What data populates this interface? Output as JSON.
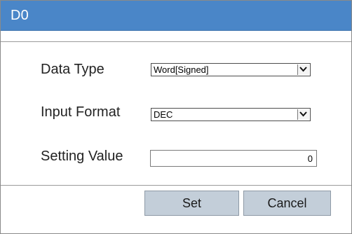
{
  "dialog": {
    "title": "D0"
  },
  "form": {
    "data_type": {
      "label": "Data Type",
      "value": "Word[Signed]",
      "icon": "chevron-down-icon"
    },
    "input_format": {
      "label": "Input Format",
      "value": "DEC",
      "icon": "chevron-down-icon"
    },
    "setting_value": {
      "label": "Setting Value",
      "value": "0"
    }
  },
  "buttons": {
    "set_label": "Set",
    "cancel_label": "Cancel"
  },
  "colors": {
    "titlebar": "#4a86c8",
    "button": "#c3ced9"
  }
}
